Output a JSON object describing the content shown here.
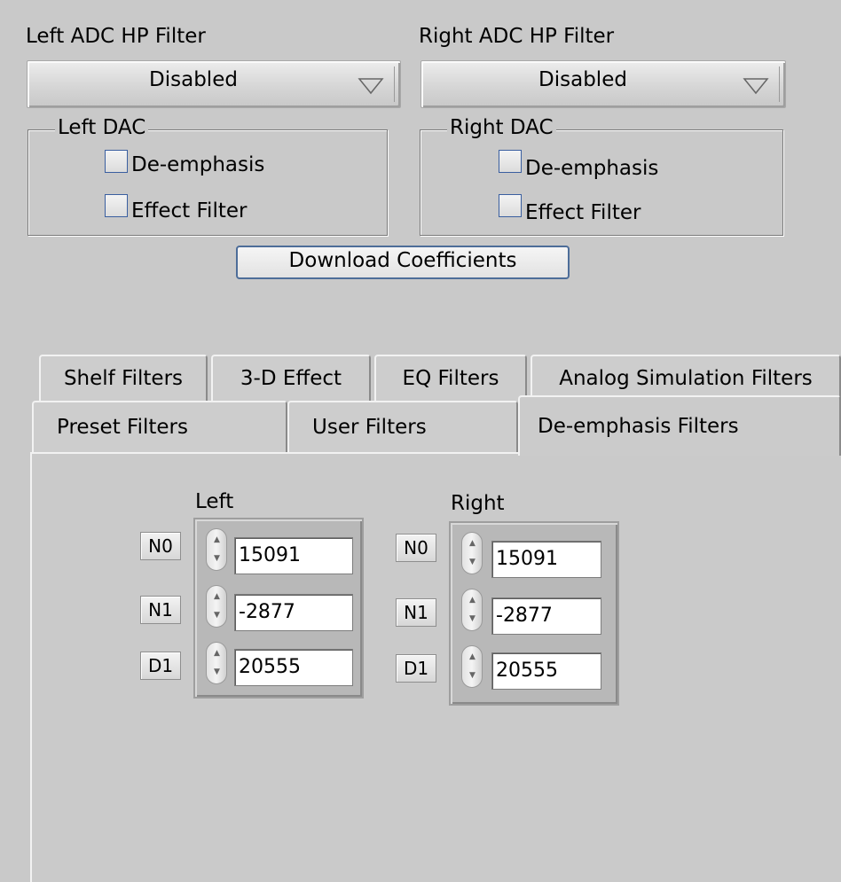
{
  "adc": {
    "left_label": "Left ADC HP Filter",
    "right_label": "Right ADC HP Filter",
    "left_value": "Disabled",
    "right_value": "Disabled"
  },
  "dac": {
    "left_title": "Left DAC",
    "right_title": "Right DAC",
    "deemphasis_label": "De-emphasis",
    "effect_filter_label": "Effect Filter"
  },
  "download_button": "Download Coefficients",
  "tabs_row1": [
    "Shelf Filters",
    "3-D Effect",
    "EQ Filters",
    "Analog Simulation Filters"
  ],
  "tabs_row2": [
    "Preset Filters",
    "User Filters",
    "De-emphasis Filters"
  ],
  "active_tab": "De-emphasis Filters",
  "deemphasis": {
    "left_title": "Left",
    "right_title": "Right",
    "left": [
      {
        "label": "N0",
        "value": "15091"
      },
      {
        "label": "N1",
        "value": "-2877"
      },
      {
        "label": "D1",
        "value": "20555"
      }
    ],
    "right": [
      {
        "label": "N0",
        "value": "15091"
      },
      {
        "label": "N1",
        "value": "-2877"
      },
      {
        "label": "D1",
        "value": "20555"
      }
    ]
  }
}
